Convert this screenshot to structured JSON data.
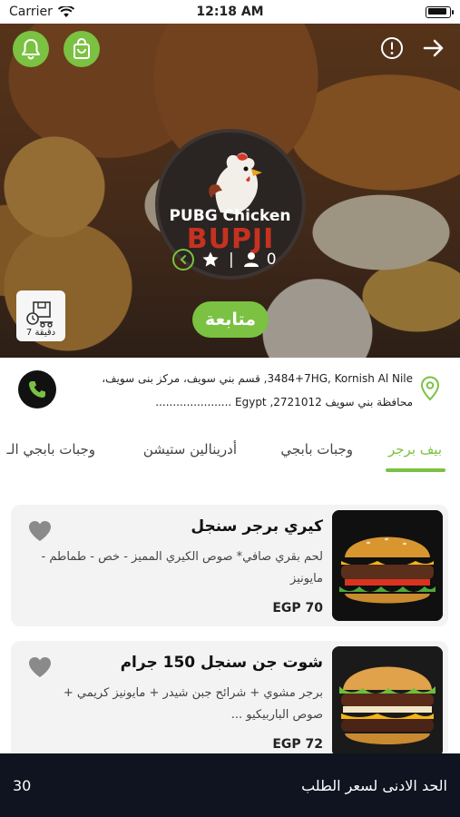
{
  "status_bar": {
    "carrier": "Carrier",
    "time": "12:18 AM"
  },
  "store": {
    "name": "PUBG Chicken",
    "logo_text": "BUPJI Chicken",
    "rating": "0",
    "followers_icon": "person-icon",
    "delivery_time": "7 دقيقة",
    "follow_label": "متابعة"
  },
  "address": {
    "line1": "3484+7HG, Kornish Al Nile, قسم بني سويف، مركز بنى سويف،",
    "line2": "محافظة بني سويف 2721012, Egypt ......................"
  },
  "tabs": [
    {
      "label": "بيف برجر",
      "active": true
    },
    {
      "label": "وجبات بابجي",
      "active": false
    },
    {
      "label": "أدرينالين ستيشن",
      "active": false
    },
    {
      "label": "وجبات بابجي الـ",
      "active": false
    }
  ],
  "products": [
    {
      "name": "كيري برجر سنجل",
      "description": "لحم بقري صافي* صوص الكيري المميز - خص - طماطم - مايونيز",
      "price": "EGP 70"
    },
    {
      "name": "شوت جن سنجل 150 جرام",
      "description": "برجر مشوي + شرائح جبن شيدر + مايونيز كريمي + صوص الباربيكيو ...",
      "price": "EGP 72"
    }
  ],
  "bottom_bar": {
    "label": "الحد الادنى لسعر الطلب",
    "value": "30"
  },
  "colors": {
    "accent": "#7bc142",
    "dark": "#0f1420",
    "card_bg": "#f3f3f3"
  }
}
